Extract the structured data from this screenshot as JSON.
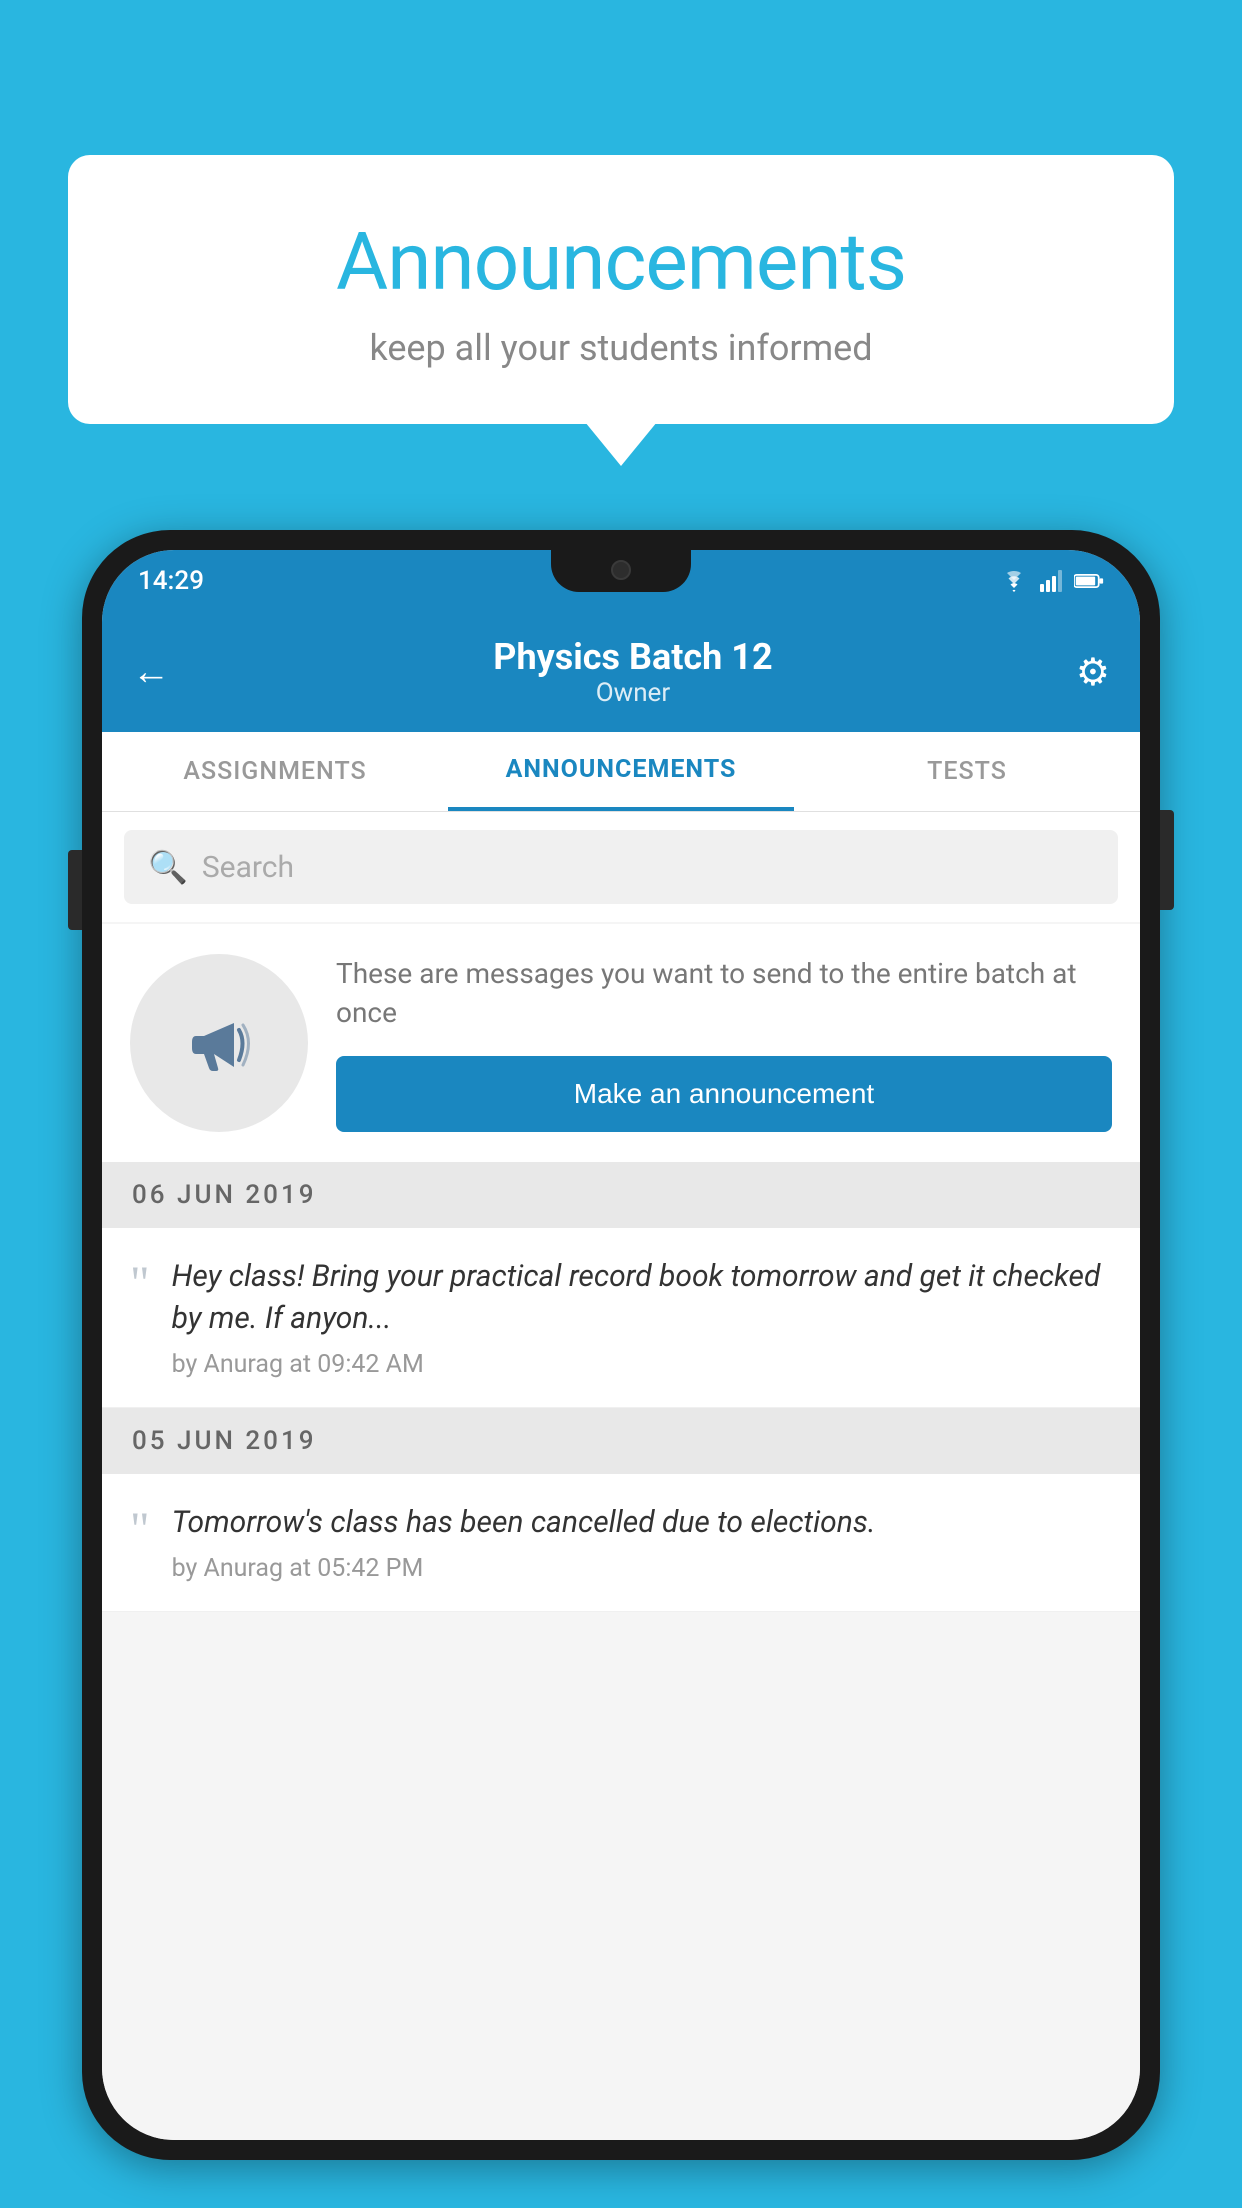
{
  "background_color": "#29b6e0",
  "speech_bubble": {
    "title": "Announcements",
    "subtitle": "keep all your students informed"
  },
  "phone": {
    "status_bar": {
      "time": "14:29"
    },
    "header": {
      "back_label": "←",
      "title": "Physics Batch 12",
      "subtitle": "Owner",
      "settings_icon": "⚙"
    },
    "tabs": [
      {
        "label": "ASSIGNMENTS",
        "active": false
      },
      {
        "label": "ANNOUNCEMENTS",
        "active": true
      },
      {
        "label": "TESTS",
        "active": false
      }
    ],
    "search": {
      "placeholder": "Search"
    },
    "promo": {
      "description": "These are messages you want to send to the entire batch at once",
      "button_label": "Make an announcement"
    },
    "date_groups": [
      {
        "date": "06  JUN  2019",
        "messages": [
          {
            "text": "Hey class! Bring your practical record book tomorrow and get it checked by me. If anyon...",
            "author": "by Anurag at 09:42 AM"
          }
        ]
      },
      {
        "date": "05  JUN  2019",
        "messages": [
          {
            "text": "Tomorrow's class has been cancelled due to elections.",
            "author": "by Anurag at 05:42 PM"
          }
        ]
      }
    ]
  }
}
